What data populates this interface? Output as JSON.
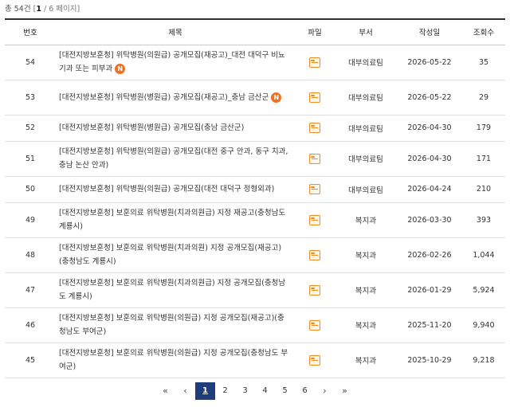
{
  "summary": {
    "total_prefix": "총 54건",
    "bracket_open": "[",
    "current_page": "1",
    "page_suffix": "/ 6 페이지",
    "bracket_close": "]"
  },
  "headers": {
    "num": "번호",
    "title": "제목",
    "file": "파일",
    "dept": "부서",
    "date": "작성일",
    "views": "조회수"
  },
  "rows": [
    {
      "num": "54",
      "title": "[대전지방보훈청] 위탁병원(의원급) 공개모집(재공고)_대전 대덕구 비뇨기과 또는 피부과",
      "new_badge": "N",
      "file_icon": "folder-icon",
      "dept": "대부의료팀",
      "date": "2026-05-22",
      "views": "35"
    },
    {
      "num": "53",
      "title": "[대전지방보훈청] 위탁병원(병원급) 공개모집(재공고)_충남 금산군",
      "new_badge": "N",
      "file_icon": "folder-icon",
      "dept": "대부의료팀",
      "date": "2026-05-22",
      "views": "29"
    },
    {
      "num": "52",
      "title": "[대전지방보훈청] 위탁병원(병원급) 공개모집(충남 금산군)",
      "new_badge": "",
      "file_icon": "folder-icon",
      "dept": "대부의료팀",
      "date": "2026-04-30",
      "views": "179"
    },
    {
      "num": "51",
      "title": "[대전지방보훈청] 위탁병원(의원급) 공개모집(대전 중구 안과, 동구 치과, 충남 논산 안과)",
      "new_badge": "",
      "file_icon": "folder-icon",
      "dept": "대부의료팀",
      "date": "2026-04-30",
      "views": "171"
    },
    {
      "num": "50",
      "title": "[대전지방보훈청] 위탁병원(의원급) 공개모집(대전 대덕구 정형외과)",
      "new_badge": "",
      "file_icon": "folder-icon",
      "dept": "대부의료팀",
      "date": "2026-04-24",
      "views": "210"
    },
    {
      "num": "49",
      "title": "[대전지방보훈청] 보훈의료 위탁병원(치과의원급) 지정 재공고(충청남도 계룡시)",
      "new_badge": "",
      "file_icon": "folder-icon",
      "dept": "복지과",
      "date": "2026-03-30",
      "views": "393"
    },
    {
      "num": "48",
      "title": "[대전지방보훈청] 보훈의료 위탁병원(치과의원) 지정 공개모집(재공고)(충청남도 계룡시)",
      "new_badge": "",
      "file_icon": "folder-icon",
      "dept": "복지과",
      "date": "2026-02-26",
      "views": "1,044"
    },
    {
      "num": "47",
      "title": "[대전지방보훈청] 보훈의료 위탁병원(치과의원급) 지정 공개모집(충청남도 계룡시)",
      "new_badge": "",
      "file_icon": "folder-icon",
      "dept": "복지과",
      "date": "2026-01-29",
      "views": "5,924"
    },
    {
      "num": "46",
      "title": "[대전지방보훈청] 보훈의료 위탁병원(의원급) 지정 공개모집(재공고)(충청남도 부여군)",
      "new_badge": "",
      "file_icon": "folder-icon",
      "dept": "복지과",
      "date": "2025-11-20",
      "views": "9,940"
    },
    {
      "num": "45",
      "title": "[대전지방보훈청] 보훈의료 위탁병원(의원급) 지정 공개모집(충청남도 부여군)",
      "new_badge": "",
      "file_icon": "folder-icon",
      "dept": "복지과",
      "date": "2025-10-29",
      "views": "9,218"
    }
  ],
  "pagination": {
    "first": "«",
    "prev": "‹",
    "pages": [
      "1",
      "2",
      "3",
      "4",
      "5",
      "6"
    ],
    "active": "1",
    "next": "›",
    "last": "»"
  },
  "colors": {
    "accent_active_page": "#1f3d7a",
    "new_badge": "#f36f21",
    "file_icon": "#f28b20"
  }
}
